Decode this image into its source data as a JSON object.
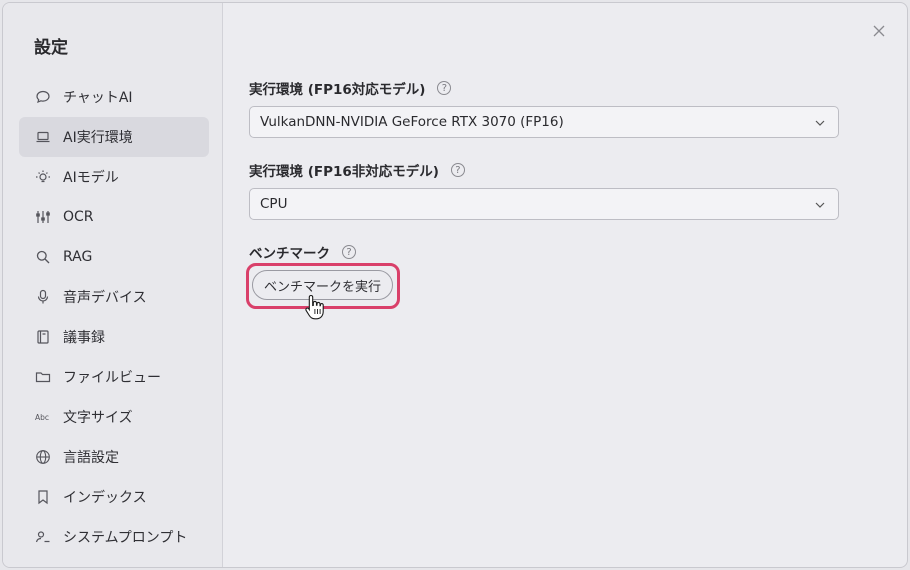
{
  "sidebar": {
    "title": "設定",
    "items": [
      {
        "label": "チャットAI",
        "icon": "chat-bubble-icon"
      },
      {
        "label": "AI実行環境",
        "icon": "laptop-icon",
        "active": true
      },
      {
        "label": "AIモデル",
        "icon": "lightbulb-icon"
      },
      {
        "label": "OCR",
        "icon": "sliders-icon"
      },
      {
        "label": "RAG",
        "icon": "search-icon"
      },
      {
        "label": "音声デバイス",
        "icon": "microphone-icon"
      },
      {
        "label": "議事録",
        "icon": "notebook-icon"
      },
      {
        "label": "ファイルビュー",
        "icon": "folder-icon"
      },
      {
        "label": "文字サイズ",
        "icon": "abc-text-icon"
      },
      {
        "label": "言語設定",
        "icon": "globe-icon"
      },
      {
        "label": "インデックス",
        "icon": "bookmark-icon"
      },
      {
        "label": "システムプロンプト",
        "icon": "user-prompt-icon"
      }
    ]
  },
  "main": {
    "fp16": {
      "label": "実行環境 (FP16対応モデル)",
      "value": "VulkanDNN-NVIDIA GeForce RTX 3070 (FP16)"
    },
    "nonfp16": {
      "label": "実行環境 (FP16非対応モデル)",
      "value": "CPU"
    },
    "benchmark": {
      "label": "ベンチマーク",
      "button": "ベンチマークを実行"
    },
    "help_glyph": "?"
  },
  "colors": {
    "highlight": "#d9406a",
    "active_nav": "#d9d9df"
  }
}
